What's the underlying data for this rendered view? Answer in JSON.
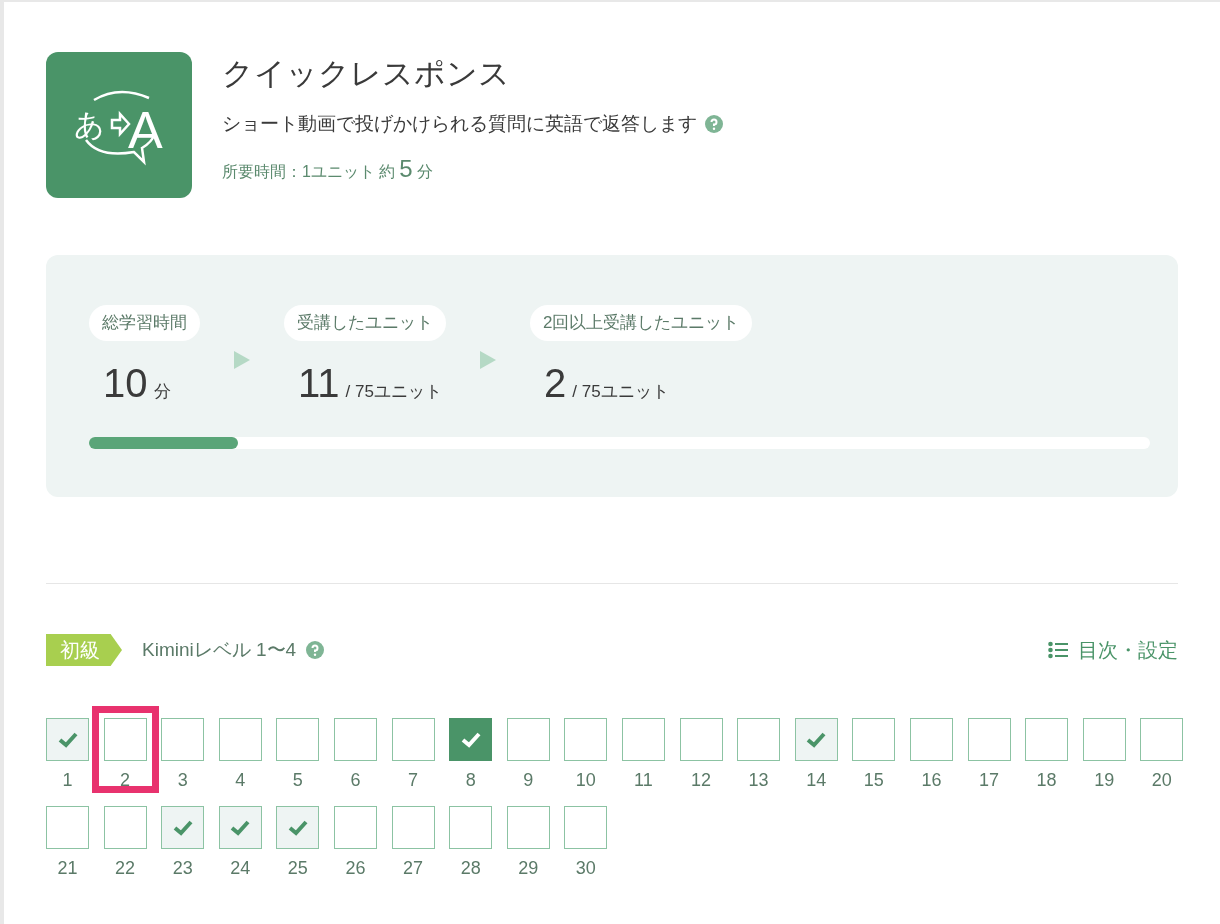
{
  "logo": {
    "source_char": "あ",
    "target_char": "A"
  },
  "course": {
    "title": "クイックレスポンス",
    "description": "ショート動画で投げかけられる質問に英語で返答します",
    "duration_label": "所要時間：1ユニット 約",
    "duration_value": "5",
    "duration_unit": "分"
  },
  "stats": [
    {
      "label": "総学習時間",
      "value": "10",
      "unit": "分"
    },
    {
      "label": "受講したユニット",
      "value": "11",
      "unit": "/ 75ユニット"
    },
    {
      "label": "2回以上受講したユニット",
      "value": "2",
      "unit": "/ 75ユニット"
    }
  ],
  "progress": {
    "level": 0.14
  },
  "level": {
    "badge": "初級",
    "label": "Kiminiレベル 1〜4",
    "menu_link": "目次・設定"
  },
  "units": [
    {
      "number": "1",
      "checked": true,
      "current": false,
      "highlighted": false
    },
    {
      "number": "2",
      "checked": false,
      "current": false,
      "highlighted": true
    },
    {
      "number": "3",
      "checked": false,
      "current": false,
      "highlighted": false
    },
    {
      "number": "4",
      "checked": false,
      "current": false,
      "highlighted": false
    },
    {
      "number": "5",
      "checked": false,
      "current": false,
      "highlighted": false
    },
    {
      "number": "6",
      "checked": false,
      "current": false,
      "highlighted": false
    },
    {
      "number": "7",
      "checked": false,
      "current": false,
      "highlighted": false
    },
    {
      "number": "8",
      "checked": true,
      "current": true,
      "highlighted": false
    },
    {
      "number": "9",
      "checked": false,
      "current": false,
      "highlighted": false
    },
    {
      "number": "10",
      "checked": false,
      "current": false,
      "highlighted": false
    },
    {
      "number": "11",
      "checked": false,
      "current": false,
      "highlighted": false
    },
    {
      "number": "12",
      "checked": false,
      "current": false,
      "highlighted": false
    },
    {
      "number": "13",
      "checked": false,
      "current": false,
      "highlighted": false
    },
    {
      "number": "14",
      "checked": true,
      "current": false,
      "highlighted": false
    },
    {
      "number": "15",
      "checked": false,
      "current": false,
      "highlighted": false
    },
    {
      "number": "16",
      "checked": false,
      "current": false,
      "highlighted": false
    },
    {
      "number": "17",
      "checked": false,
      "current": false,
      "highlighted": false
    },
    {
      "number": "18",
      "checked": false,
      "current": false,
      "highlighted": false
    },
    {
      "number": "19",
      "checked": false,
      "current": false,
      "highlighted": false
    },
    {
      "number": "20",
      "checked": false,
      "current": false,
      "highlighted": false
    },
    {
      "number": "21",
      "checked": false,
      "current": false,
      "highlighted": false
    },
    {
      "number": "22",
      "checked": false,
      "current": false,
      "highlighted": false
    },
    {
      "number": "23",
      "checked": true,
      "current": false,
      "highlighted": false
    },
    {
      "number": "24",
      "checked": true,
      "current": false,
      "highlighted": false
    },
    {
      "number": "25",
      "checked": true,
      "current": false,
      "highlighted": false
    },
    {
      "number": "26",
      "checked": false,
      "current": false,
      "highlighted": false
    },
    {
      "number": "27",
      "checked": false,
      "current": false,
      "highlighted": false
    },
    {
      "number": "28",
      "checked": false,
      "current": false,
      "highlighted": false
    },
    {
      "number": "29",
      "checked": false,
      "current": false,
      "highlighted": false
    },
    {
      "number": "30",
      "checked": false,
      "current": false,
      "highlighted": false
    }
  ]
}
